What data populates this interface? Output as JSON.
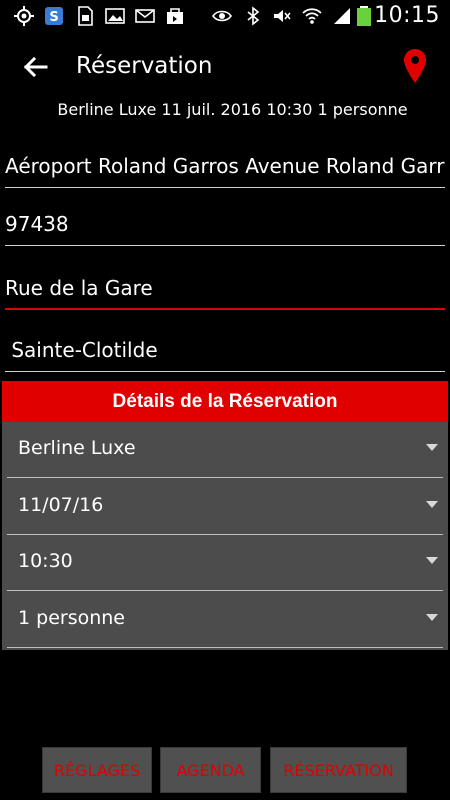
{
  "status_bar": {
    "time": "10:15",
    "icons": [
      "gps-icon",
      "skype-icon",
      "sim-icon",
      "image-icon",
      "mail-icon",
      "bag-icon",
      "eye-icon",
      "bluetooth-icon",
      "mute-icon",
      "wifi-icon",
      "signal-icon",
      "battery-icon"
    ]
  },
  "app_bar": {
    "title": "Réservation",
    "back_icon": "arrow-left-icon",
    "location_icon": "map-pin-icon"
  },
  "summary": "Berline Luxe 11 juil. 2016 10:30 1 personne",
  "fields": {
    "pickup_address": "Aéroport Roland Garros Avenue Roland Garros",
    "postal_code": "97438",
    "street": "Rue de la Gare",
    "city": " Sainte-Clotilde"
  },
  "section": {
    "title": "Détails de la Réservation",
    "vehicle": "Berline Luxe",
    "date": "11/07/16",
    "time": "10:30",
    "passengers": "1 personne"
  },
  "buttons": {
    "settings": "RÉGLAGES",
    "agenda": "AGENDA",
    "reservation": "RÉSERVATION"
  },
  "colors": {
    "accent": "#e00000",
    "background": "#000000",
    "panel": "#4c4c4c",
    "button_bg": "#505050"
  }
}
